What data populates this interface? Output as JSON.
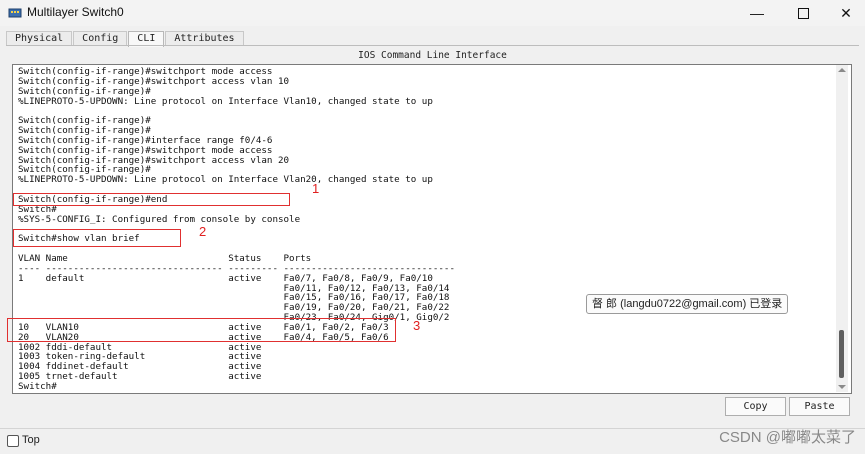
{
  "window": {
    "title": "Multilayer Switch0",
    "icon": "cisco-switch-icon",
    "controls": {
      "minimize": "—",
      "close": "✕"
    }
  },
  "tabs": [
    {
      "label": "Physical",
      "active": false
    },
    {
      "label": "Config",
      "active": false
    },
    {
      "label": "CLI",
      "active": true
    },
    {
      "label": "Attributes",
      "active": false
    }
  ],
  "cli": {
    "header": "IOS Command Line Interface",
    "lines": [
      "Switch(config-if-range)#switchport mode access",
      "Switch(config-if-range)#switchport access vlan 10",
      "Switch(config-if-range)#",
      "%LINEPROTO-5-UPDOWN: Line protocol on Interface Vlan10, changed state to up",
      "",
      "Switch(config-if-range)#",
      "Switch(config-if-range)#",
      "Switch(config-if-range)#interface range f0/4-6",
      "Switch(config-if-range)#switchport mode access",
      "Switch(config-if-range)#switchport access vlan 20",
      "Switch(config-if-range)#",
      "%LINEPROTO-5-UPDOWN: Line protocol on Interface Vlan20, changed state to up",
      "",
      "Switch(config-if-range)#end",
      "Switch#",
      "%SYS-5-CONFIG_I: Configured from console by console",
      "",
      "Switch#show vlan brief",
      "",
      "VLAN Name                             Status    Ports",
      "---- -------------------------------- --------- -------------------------------",
      "1    default                          active    Fa0/7, Fa0/8, Fa0/9, Fa0/10",
      "                                                Fa0/11, Fa0/12, Fa0/13, Fa0/14",
      "                                                Fa0/15, Fa0/16, Fa0/17, Fa0/18",
      "                                                Fa0/19, Fa0/20, Fa0/21, Fa0/22",
      "                                                Fa0/23, Fa0/24, Gig0/1, Gig0/2",
      "10   VLAN10                           active    Fa0/1, Fa0/2, Fa0/3",
      "20   VLAN20                           active    Fa0/4, Fa0/5, Fa0/6",
      "1002 fddi-default                     active",
      "1003 token-ring-default               active",
      "1004 fddinet-default                  active",
      "1005 trnet-default                    active",
      "Switch#"
    ]
  },
  "annotations": [
    {
      "number": "1",
      "color": "#e03030"
    },
    {
      "number": "2",
      "color": "#e03030"
    },
    {
      "number": "3",
      "color": "#e03030"
    }
  ],
  "tooltip": "督 郎 (langdu0722@gmail.com) 已登录",
  "buttons": {
    "copy": "Copy",
    "paste": "Paste"
  },
  "top_checkbox": {
    "label": "Top",
    "checked": false
  },
  "watermark": "CSDN @嘟嘟太菜了"
}
